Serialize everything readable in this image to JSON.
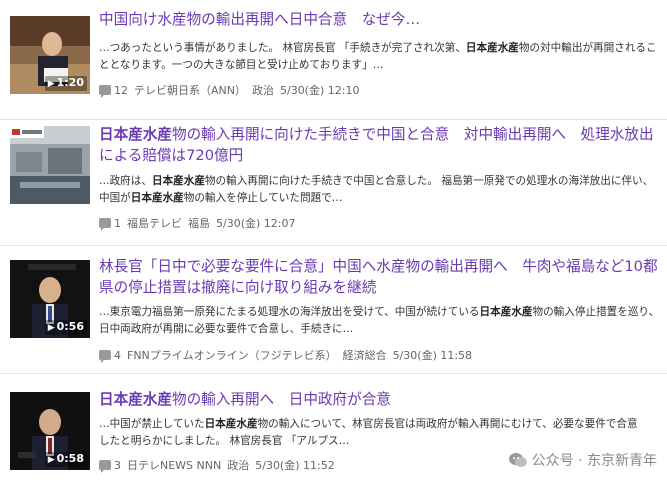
{
  "articles": [
    {
      "title_parts": [
        {
          "text": "中国向け水産物の輸出再開へ日中合意　なぜ今…",
          "bold": false
        }
      ],
      "snippet_parts": [
        {
          "text": "…つあったという事情がありました。 林官房長官 「手続きが完了され次第、",
          "bold": false
        },
        {
          "text": "日本産水産",
          "bold": true
        },
        {
          "text": "物の対中輸出が再開されることとなります。一つの大きな節目と受け止めております」…",
          "bold": false
        }
      ],
      "duration": "1:20",
      "comments": "12",
      "source": "テレビ朝日系（ANN）",
      "category": "政治",
      "datetime": "5/30(金) 12:10"
    },
    {
      "title_parts": [
        {
          "text": "日本産水産",
          "bold": true
        },
        {
          "text": "物の輸入再開に向けた手続きで中国と合意　対中輸出再開へ　処理水放出による賠償は720億円",
          "bold": false
        }
      ],
      "snippet_parts": [
        {
          "text": "…政府は、",
          "bold": false
        },
        {
          "text": "日本産水産",
          "bold": true
        },
        {
          "text": "物の輸入再開に向けた手続きで中国と合意した。 福島第一原発での処理水の海洋放出に伴い、中国が",
          "bold": false
        },
        {
          "text": "日本産水産",
          "bold": true
        },
        {
          "text": "物の輸入を停止していた問題で…",
          "bold": false
        }
      ],
      "duration": "",
      "comments": "1",
      "source": "福島テレビ",
      "category": "福島",
      "datetime": "5/30(金) 12:07"
    },
    {
      "title_parts": [
        {
          "text": "林長官「日中で必要な要件に合意」中国へ水産物の輸出再開へ　牛肉や福島など10都県の停止措置は撤廃に向け取り組みを継続",
          "bold": false
        }
      ],
      "snippet_parts": [
        {
          "text": "…東京電力福島第一原発にたまる処理水の海洋放出を受けて、中国が続けている",
          "bold": false
        },
        {
          "text": "日本産水産",
          "bold": true
        },
        {
          "text": "物の輸入停止措置を巡り、日中両政府が再開に必要な要件で合意し、手続きに…",
          "bold": false
        }
      ],
      "duration": "0:56",
      "comments": "4",
      "source": "FNNプライムオンライン（フジテレビ系）",
      "category": "経済総合",
      "datetime": "5/30(金) 11:58"
    },
    {
      "title_parts": [
        {
          "text": "日本産水産",
          "bold": true
        },
        {
          "text": "物の輸入再開へ　日中政府が合意",
          "bold": false
        }
      ],
      "snippet_parts": [
        {
          "text": "…中国が禁止していた",
          "bold": false
        },
        {
          "text": "日本産水産",
          "bold": true
        },
        {
          "text": "物の輸入について、林官房長官は両政府が輸入再開にむけて、必要な要件で合意したと明らかにしました。 林官房長官 「アルプス…",
          "bold": false
        }
      ],
      "duration": "0:58",
      "comments": "3",
      "source": "日テレNEWS NNN",
      "category": "政治",
      "datetime": "5/30(金) 11:52"
    }
  ],
  "watermark": "公众号 · 东京新青年",
  "colors": {
    "title": "#6a3ab2",
    "meta": "#666666",
    "divider": "#e3e3e3"
  },
  "icons": [
    "comment-icon",
    "play-icon",
    "wechat-icon"
  ]
}
